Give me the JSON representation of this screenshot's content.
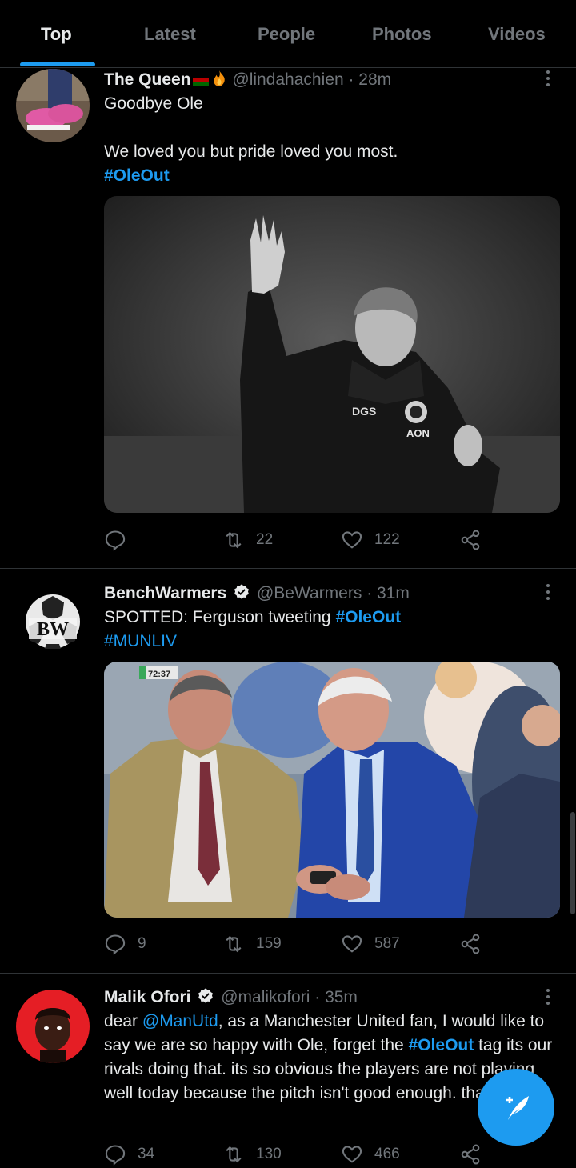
{
  "tabs": [
    {
      "label": "Top",
      "active": true
    },
    {
      "label": "Latest"
    },
    {
      "label": "People"
    },
    {
      "label": "Photos"
    },
    {
      "label": "Videos"
    }
  ],
  "tweets": [
    {
      "name": "The Queen",
      "handle": "@lindahachien",
      "time": "· 28m",
      "text_lines": [
        "Goodbye Ole",
        "",
        "We loved you but pride loved you most."
      ],
      "hashtag": "#OleOut",
      "media_caption": "DGS",
      "media_sponsor": "AON",
      "replies": "",
      "retweets": "22",
      "likes": "122"
    },
    {
      "name": "BenchWarmers",
      "handle": "@BeWarmers",
      "time": "· 31m",
      "avatar_text": "BW",
      "text_prefix": "SPOTTED: Ferguson tweeting ",
      "hashtag": "#OleOut",
      "hashtag2": "#MUNLIV",
      "media_clock": "72:37",
      "replies": "9",
      "retweets": "159",
      "likes": "587"
    },
    {
      "name": "Malik Ofori",
      "handle": "@malikofori",
      "time": "· 35m",
      "text_1": "dear ",
      "mention": "@ManUtd",
      "text_2": ", as a Manchester United fan, I would like to say we are so happy with Ole, forget the ",
      "hashtag": "#OleOut",
      "text_3": " tag its our rivals doing that. its so obvious the players are not playing well today because the pitch isn't good enough. thank you",
      "replies": "34",
      "retweets": "130",
      "likes": "466"
    }
  ],
  "colors": {
    "accent": "#1d9bf0",
    "background": "#000000",
    "secondary_text": "#71767b",
    "divider": "#2f3336"
  },
  "icons": {
    "reply": "reply-icon",
    "retweet": "retweet-icon",
    "like": "heart-icon",
    "share": "share-icon",
    "compose": "compose-tweet-icon",
    "verified": "verified-badge-icon",
    "more": "more-options-icon"
  }
}
